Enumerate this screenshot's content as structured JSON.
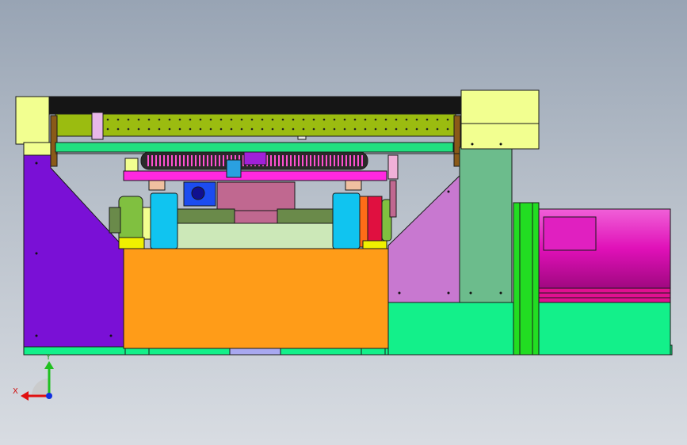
{
  "triad": {
    "x_label": "X",
    "y_label": "Y"
  },
  "colors": {
    "background_top": "#98a4b4",
    "background_bottom": "#d8dce2",
    "left_frame": "#7a10d6",
    "base_plate": "#ff9c18",
    "cooling_green": "#13f08a",
    "dark_green_post": "#22dd22",
    "motor_magenta": "#e010b8",
    "gantry_lime": "#9bbc10",
    "pale_yellow_block": "#f2ff90",
    "cyan_block": "#10c4f0",
    "mauve_block": "#c06890",
    "lilac_brace": "#c878d0",
    "teal_column": "#6cbc8c"
  }
}
